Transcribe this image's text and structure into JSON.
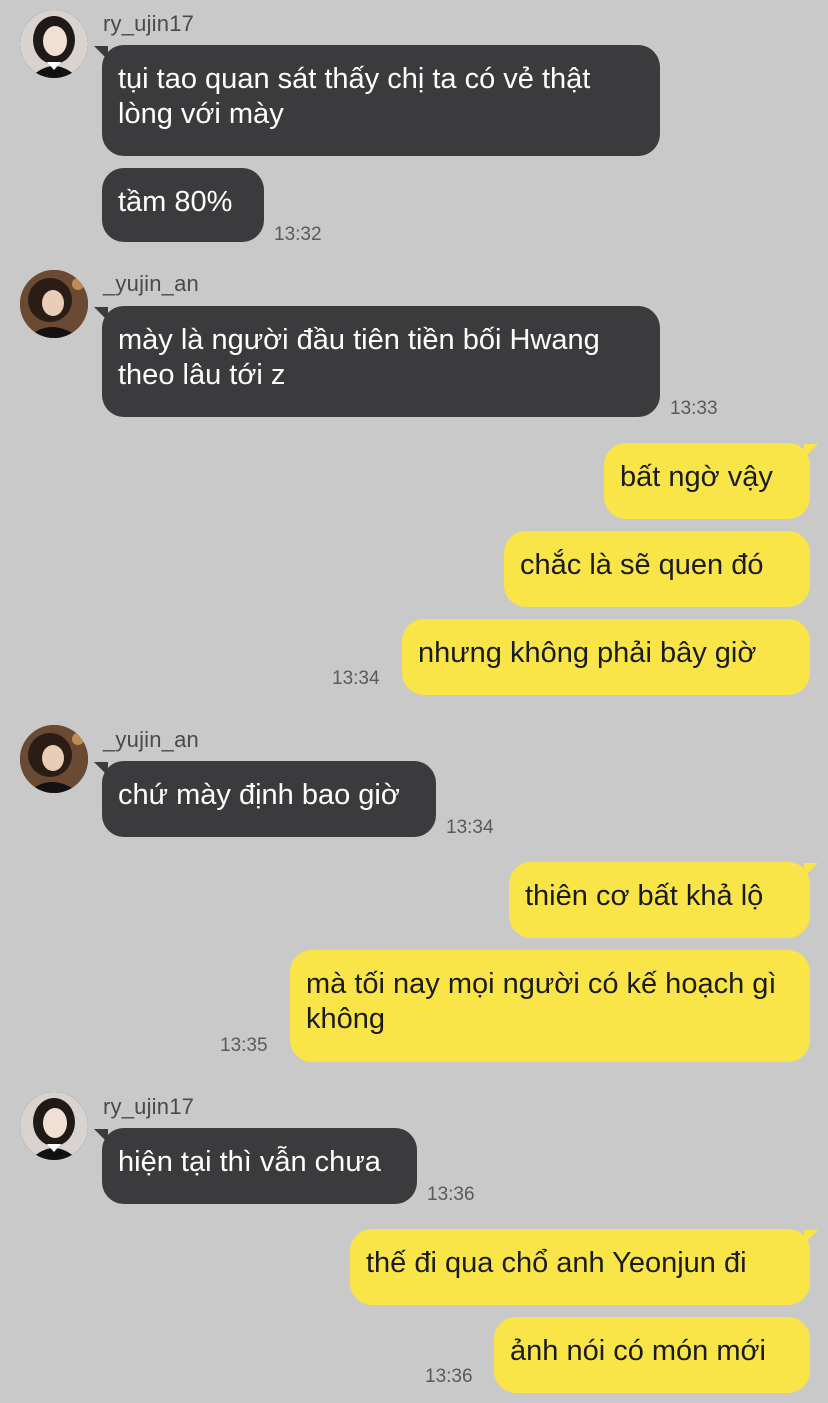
{
  "messages": [
    {
      "sender": "ry_ujin17",
      "text": "tụi tao quan sát thấy chị ta có vẻ thật lòng với mày"
    },
    {
      "text": "tầm 80%",
      "time": "13:32"
    },
    {
      "sender": "_yujin_an",
      "text": "mày là người đầu tiên tiền bối Hwang theo lâu tới z",
      "time": "13:33"
    },
    {
      "text": "bất ngờ vậy"
    },
    {
      "text": "chắc là sẽ quen đó"
    },
    {
      "text": "nhưng không phải bây giờ",
      "time": "13:34"
    },
    {
      "sender": "_yujin_an",
      "text": "chứ mày định bao giờ",
      "time": "13:34"
    },
    {
      "text": "thiên cơ bất khả lộ"
    },
    {
      "text": "mà tối nay mọi người có kế hoạch gì không",
      "time": "13:35"
    },
    {
      "sender": "ry_ujin17",
      "text": "hiện tại thì vẫn chưa",
      "time": "13:36"
    },
    {
      "text": "thế đi qua chổ anh Yeonjun đi"
    },
    {
      "text": "ảnh nói có món mới",
      "time": "13:36"
    }
  ],
  "colors": {
    "background": "#c9c9c9",
    "incoming_bubble": "#3b3b3d",
    "outgoing_bubble": "#f9e547"
  }
}
